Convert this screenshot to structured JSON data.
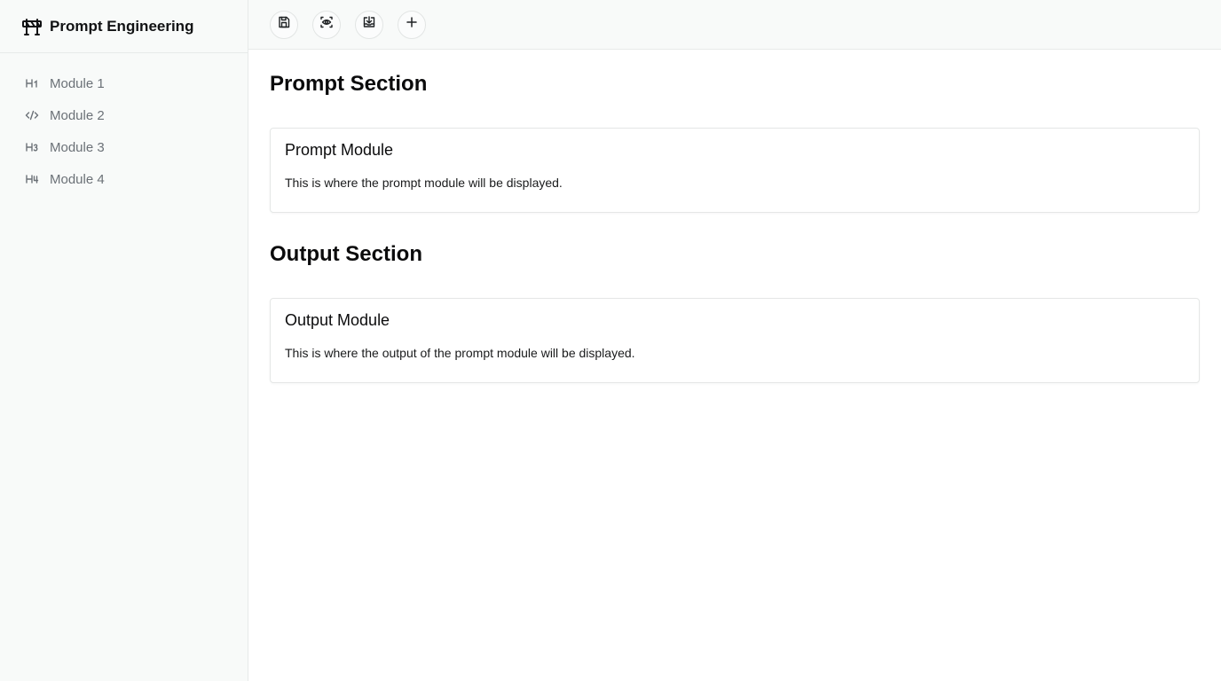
{
  "app": {
    "title": "Prompt Engineering",
    "logo_icon": "road-barrier-icon"
  },
  "sidebar": {
    "items": [
      {
        "label": "Module 1",
        "icon": "heading-1-icon",
        "glyph": "H1"
      },
      {
        "label": "Module 2",
        "icon": "code-icon",
        "glyph": "</>"
      },
      {
        "label": "Module 3",
        "icon": "heading-3-icon",
        "glyph": "H3"
      },
      {
        "label": "Module 4",
        "icon": "heading-4-icon",
        "glyph": "H4"
      }
    ]
  },
  "toolbar": {
    "buttons": [
      {
        "icon": "save-icon"
      },
      {
        "icon": "preview-icon"
      },
      {
        "icon": "download-icon"
      },
      {
        "icon": "add-icon"
      }
    ]
  },
  "main": {
    "prompt_section": {
      "title": "Prompt Section",
      "card_title": "Prompt Module",
      "card_body": "This is where the prompt module will be displayed."
    },
    "output_section": {
      "title": "Output Section",
      "card_title": "Output Module",
      "card_body": "This is where the output of the prompt module will be displayed."
    }
  },
  "colors": {
    "sidebar_bg": "#f8faf9",
    "border": "#e7eae9",
    "muted_text": "#6b7177",
    "text": "#0b0b0c"
  }
}
